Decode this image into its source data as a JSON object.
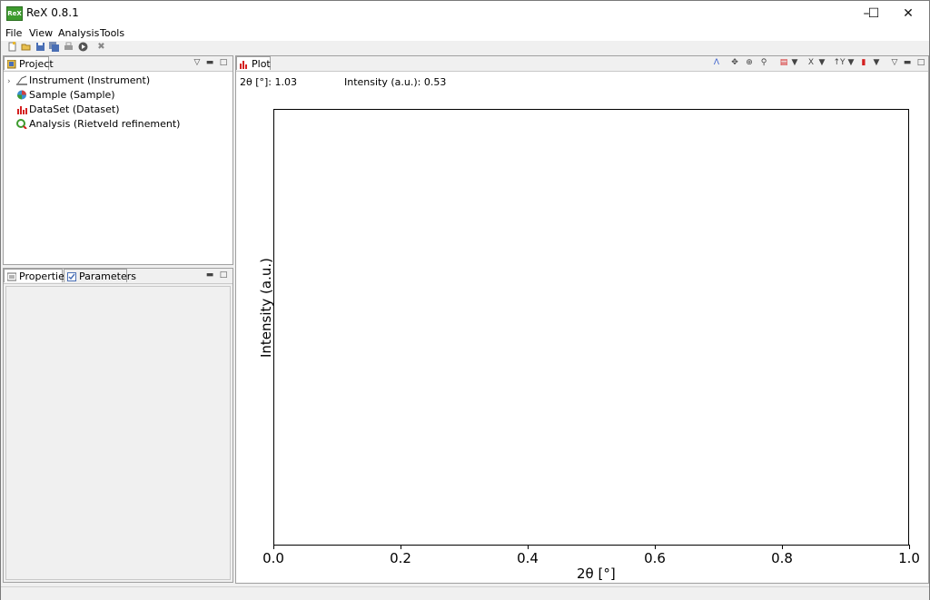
{
  "window": {
    "title": "ReX 0.8.1",
    "app_icon_text": "ReX"
  },
  "menu": [
    "File",
    "View",
    "Analysis",
    "Tools"
  ],
  "toolbar_icons": [
    "new-file-icon",
    "open-folder-icon",
    "save-icon",
    "save-all-icon",
    "print-icon",
    "run-icon",
    "close-icon"
  ],
  "project_panel": {
    "tab_label": "Project",
    "items": [
      {
        "label": "Instrument (Instrument)",
        "icon": "instrument-icon",
        "expandable": true
      },
      {
        "label": "Sample (Sample)",
        "icon": "sample-icon",
        "expandable": false
      },
      {
        "label": "DataSet (Dataset)",
        "icon": "dataset-icon",
        "expandable": false
      },
      {
        "label": "Analysis (Rietveld refinement)",
        "icon": "analysis-icon",
        "expandable": false
      }
    ]
  },
  "properties_panel": {
    "tabs": [
      "Properties",
      "Parameters"
    ]
  },
  "plot_panel": {
    "tab_label": "Plot",
    "toolbar_labels": {
      "x_axis": "X",
      "y_axis": "↑Y"
    },
    "readout": {
      "x": "2θ [°]: 1.03",
      "y": "Intensity (a.u.): 0.53"
    }
  },
  "chart_data": {
    "type": "line",
    "series": [],
    "xlabel": "2θ [°]",
    "ylabel": "Intensity (a.u.)",
    "xlim": [
      0.0,
      1.0
    ],
    "x_ticks": [
      "0.0",
      "0.2",
      "0.4",
      "0.6",
      "0.8",
      "1.0"
    ],
    "y_ticks": [],
    "grid": false
  },
  "colors": {
    "accent_green": "#3d9b2e",
    "chart_red": "#d42020",
    "chart_blue": "#3a5fcd"
  }
}
